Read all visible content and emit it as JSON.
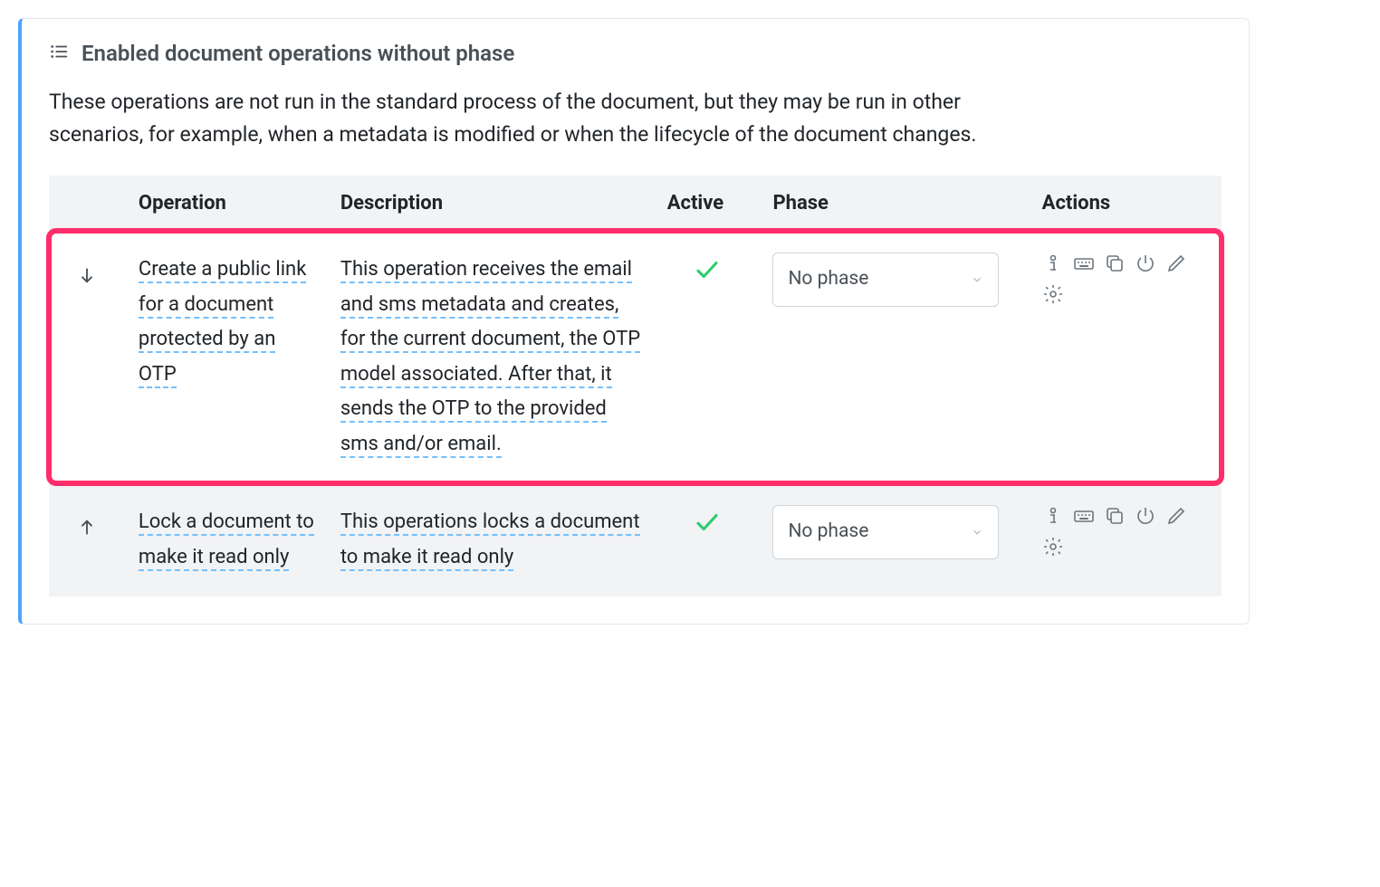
{
  "panel": {
    "title": "Enabled document operations without phase",
    "description": "These operations are not run in the standard process of the document, but they may be run in other scenarios, for example, when a metadata is modified or when the lifecycle of the document changes."
  },
  "table": {
    "headers": {
      "operation": "Operation",
      "description": "Description",
      "active": "Active",
      "phase": "Phase",
      "actions": "Actions"
    },
    "rows": [
      {
        "direction": "down",
        "operation": "Create a public link for a document protected by an OTP",
        "description": "This operation receives the email and sms metadata and creates, for the current document, the OTP model associated. After that, it sends the OTP to the provided sms and/or email.",
        "active": true,
        "phase": "No phase",
        "highlighted": true
      },
      {
        "direction": "up",
        "operation": "Lock a document to make it read only",
        "description": "This operations locks a document to make it read only",
        "active": true,
        "phase": "No phase",
        "highlighted": false
      }
    ]
  }
}
